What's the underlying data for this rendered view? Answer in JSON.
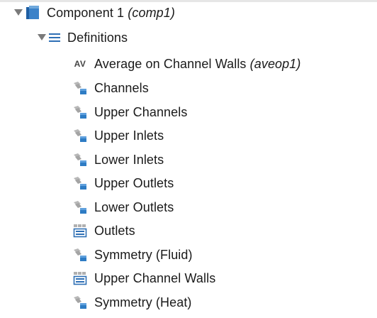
{
  "tree": {
    "component": {
      "label": "Component 1",
      "tag": "(comp1)",
      "icon": "component-cube-icon",
      "expanded": true
    },
    "definitions": {
      "label": "Definitions",
      "icon": "list-lines-icon",
      "expanded": true
    },
    "items": [
      {
        "label": "Average on Channel Walls",
        "tag": "(aveop1)",
        "icon": "average-operator-av-icon",
        "av_text": "AV"
      },
      {
        "label": "Channels",
        "tag": "",
        "icon": "selection-domain-icon"
      },
      {
        "label": "Upper Channels",
        "tag": "",
        "icon": "selection-domain-icon"
      },
      {
        "label": "Upper Inlets",
        "tag": "",
        "icon": "selection-domain-icon"
      },
      {
        "label": "Lower Inlets",
        "tag": "",
        "icon": "selection-domain-icon"
      },
      {
        "label": "Upper Outlets",
        "tag": "",
        "icon": "selection-domain-icon"
      },
      {
        "label": "Lower Outlets",
        "tag": "",
        "icon": "selection-domain-icon"
      },
      {
        "label": "Outlets",
        "tag": "",
        "icon": "union-selection-icon"
      },
      {
        "label": "Symmetry (Fluid)",
        "tag": "",
        "icon": "selection-domain-icon"
      },
      {
        "label": "Upper Channel Walls",
        "tag": "",
        "icon": "union-selection-icon"
      },
      {
        "label": "Symmetry (Heat)",
        "tag": "",
        "icon": "selection-domain-icon"
      }
    ]
  },
  "colors": {
    "accent": "#2e6fb5",
    "icon_gray": "#9a9a9a"
  }
}
